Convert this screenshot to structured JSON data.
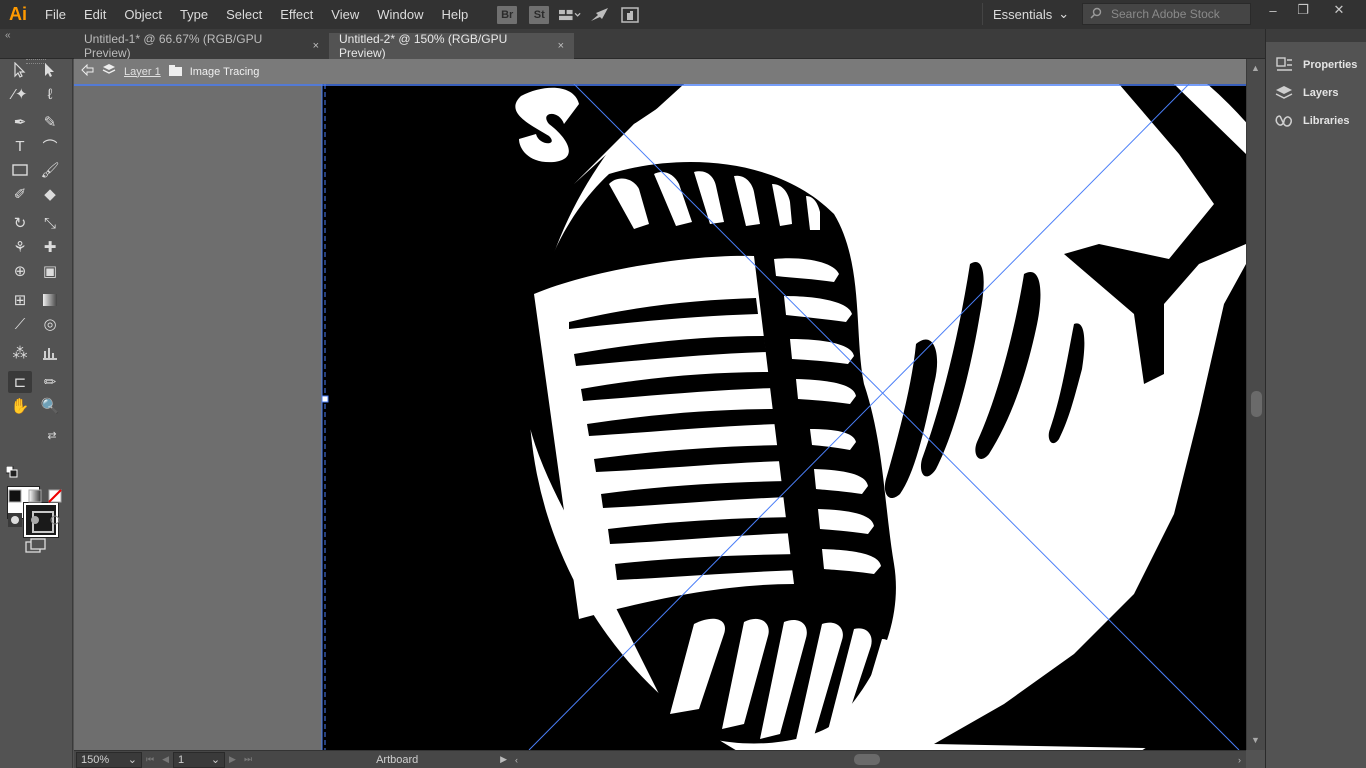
{
  "app": {
    "logo": "Ai"
  },
  "menu": [
    "File",
    "Edit",
    "Object",
    "Type",
    "Select",
    "Effect",
    "View",
    "Window",
    "Help"
  ],
  "app_switcher": {
    "bridge": "Br",
    "stock": "St"
  },
  "workspace": {
    "label": "Essentials"
  },
  "stock_search": {
    "placeholder": "Search Adobe Stock"
  },
  "tabs": [
    {
      "label": "Untitled-1* @ 66.67% (RGB/GPU Preview)",
      "close": "×",
      "active": false
    },
    {
      "label": "Untitled-2* @ 150% (RGB/GPU Preview)",
      "close": "×",
      "active": true
    }
  ],
  "breadcrumb": {
    "layer": "Layer 1",
    "group": "Image Tracing"
  },
  "right_panel": {
    "items": [
      "Properties",
      "Layers",
      "Libraries"
    ]
  },
  "status": {
    "zoom": "150%",
    "artboard_number": "1",
    "mode": "Artboard"
  },
  "colors": {
    "fill": "#ffffff",
    "stroke": "#1a1a1a",
    "guide": "#4a7ef7",
    "artwork": "#000000"
  }
}
